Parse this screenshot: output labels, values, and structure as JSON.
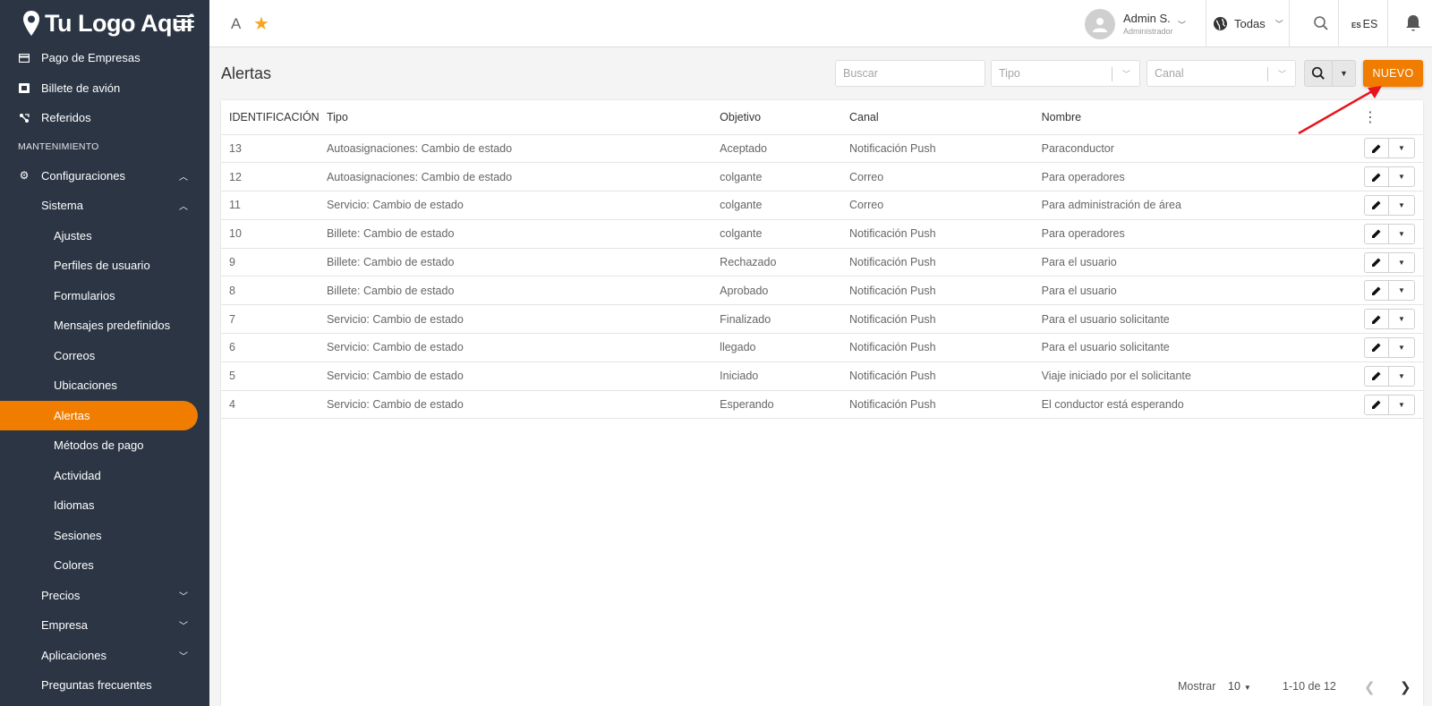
{
  "app": {
    "logo_text": "Tu Logo Aquí"
  },
  "sidebar": {
    "items": [
      {
        "label": "Pago de Empresas"
      },
      {
        "label": "Billete de avión"
      },
      {
        "label": "Referidos"
      }
    ],
    "section_title": "MANTENIMIENTO",
    "config_label": "Configuraciones",
    "sistema_label": "Sistema",
    "sistema_items": [
      {
        "label": "Ajustes"
      },
      {
        "label": "Perfiles de usuario"
      },
      {
        "label": "Formularios"
      },
      {
        "label": "Mensajes predefinidos"
      },
      {
        "label": "Correos"
      },
      {
        "label": "Ubicaciones"
      },
      {
        "label": "Alertas"
      },
      {
        "label": "Métodos de pago"
      },
      {
        "label": "Actividad"
      },
      {
        "label": "Idiomas"
      },
      {
        "label": "Sesiones"
      },
      {
        "label": "Colores"
      }
    ],
    "bottom_items": [
      {
        "label": "Precios"
      },
      {
        "label": "Empresa"
      },
      {
        "label": "Aplicaciones"
      },
      {
        "label": "Preguntas frecuentes"
      }
    ],
    "active_color": "#f07d00",
    "bg_color": "#2b3544"
  },
  "topbar": {
    "letter": "A",
    "user_name": "Admin S.",
    "user_role": "Administrador",
    "region": "Todas",
    "lang_flag": "ES",
    "lang": "ES"
  },
  "page": {
    "title": "Alertas",
    "search_placeholder": "Buscar",
    "tipo_placeholder": "Tipo",
    "canal_placeholder": "Canal",
    "new_button": "NUEVO"
  },
  "table": {
    "headers": {
      "id": "IDENTIFICACIÓN",
      "tipo": "Tipo",
      "objetivo": "Objetivo",
      "canal": "Canal",
      "nombre": "Nombre"
    },
    "rows": [
      {
        "id": "13",
        "tipo": "Autoasignaciones: Cambio de estado",
        "objetivo": "Aceptado",
        "canal": "Notificación Push",
        "nombre": "Paraconductor"
      },
      {
        "id": "12",
        "tipo": "Autoasignaciones: Cambio de estado",
        "objetivo": "colgante",
        "canal": "Correo",
        "nombre": "Para operadores"
      },
      {
        "id": "11",
        "tipo": "Servicio: Cambio de estado",
        "objetivo": "colgante",
        "canal": "Correo",
        "nombre": "Para administración de área"
      },
      {
        "id": "10",
        "tipo": "Billete: Cambio de estado",
        "objetivo": "colgante",
        "canal": "Notificación Push",
        "nombre": "Para operadores"
      },
      {
        "id": "9",
        "tipo": "Billete: Cambio de estado",
        "objetivo": "Rechazado",
        "canal": "Notificación Push",
        "nombre": "Para el usuario"
      },
      {
        "id": "8",
        "tipo": "Billete: Cambio de estado",
        "objetivo": "Aprobado",
        "canal": "Notificación Push",
        "nombre": "Para el usuario"
      },
      {
        "id": "7",
        "tipo": "Servicio: Cambio de estado",
        "objetivo": "Finalizado",
        "canal": "Notificación Push",
        "nombre": "Para el usuario solicitante"
      },
      {
        "id": "6",
        "tipo": "Servicio: Cambio de estado",
        "objetivo": "llegado",
        "canal": "Notificación Push",
        "nombre": "Para el usuario solicitante"
      },
      {
        "id": "5",
        "tipo": "Servicio: Cambio de estado",
        "objetivo": "Iniciado",
        "canal": "Notificación Push",
        "nombre": "Viaje iniciado por el solicitante"
      },
      {
        "id": "4",
        "tipo": "Servicio: Cambio de estado",
        "objetivo": "Esperando",
        "canal": "Notificación Push",
        "nombre": "El conductor está esperando"
      }
    ]
  },
  "pagination": {
    "show_label": "Mostrar",
    "page_size": "10",
    "range": "1-10 de 12"
  },
  "colors": {
    "accent": "#f07d00",
    "star": "#f5a623",
    "annotation_arrow": "#e8141c"
  }
}
